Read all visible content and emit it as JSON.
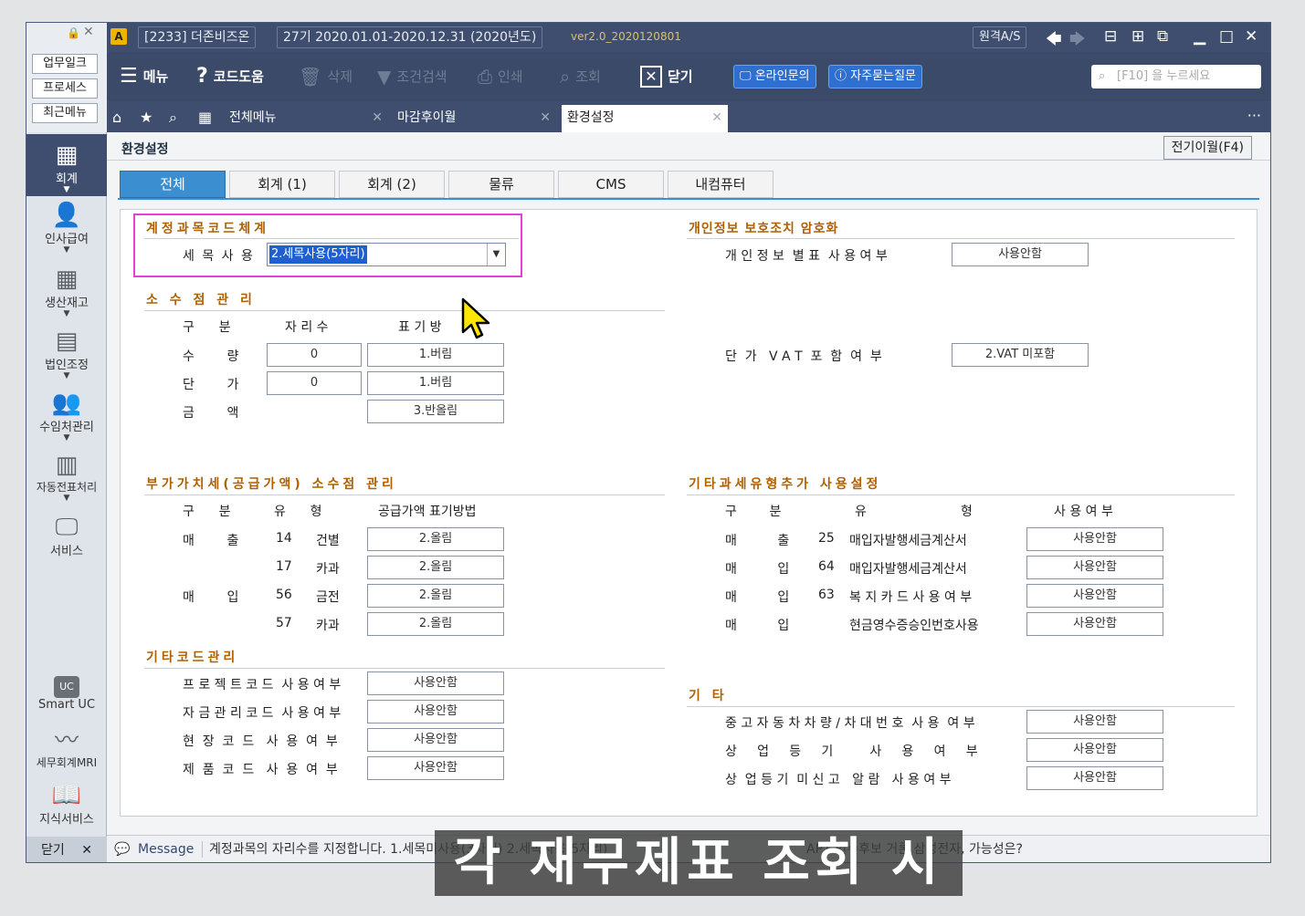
{
  "titlebar": {
    "company": "[2233] 더존비즈온",
    "period": "27기  2020.01.01-2020.12.31  (2020년도)",
    "version": "ver2.0_2020120801",
    "remote": "원격A/S"
  },
  "sidebar": {
    "buttons": [
      "업무일크",
      "프로세스",
      "최근메뉴"
    ],
    "nav": [
      "회계",
      "인사급여",
      "생산재고",
      "법인조정",
      "수임처관리",
      "자동전표처리",
      "서비스"
    ],
    "bottom": [
      "Smart UC",
      "세무회계MRI",
      "지식서비스"
    ],
    "close_label": "닫기",
    "uc_badge": "UC"
  },
  "toolbar": {
    "menu": "메뉴",
    "code_help": "코드도움",
    "delete": "삭제",
    "condition_search": "조건검색",
    "print": "인쇄",
    "inquiry": "조회",
    "close": "닫기",
    "online_inquiry": "온라인문의",
    "faq": "자주묻는질문",
    "search_placeholder": "[F10] 을 누르세요"
  },
  "doc_tabs": [
    "전체메뉴",
    "마감후이월",
    "환경설정"
  ],
  "page": {
    "title": "환경설정",
    "carryover_button": "전기이월(F4)",
    "tabs": [
      "전체",
      "회계 (1)",
      "회계 (2)",
      "물류",
      "CMS",
      "내컴퓨터"
    ]
  },
  "account_code": {
    "title": "계정과목코드체계",
    "label": "세 목 사 용",
    "value": "2.세목사용(5자리)"
  },
  "decimal": {
    "title": "소 수 점  관 리",
    "headers": [
      "구      분",
      "자 리 수",
      "표 기 방"
    ],
    "rows": [
      {
        "label": "수        량",
        "digits": "0",
        "method": "1.버림"
      },
      {
        "label": "단        가",
        "digits": "0",
        "method": "1.버림"
      },
      {
        "label": "금        액",
        "method": "3.반올림"
      }
    ]
  },
  "privacy": {
    "title": "개인정보 보호조치 암호화",
    "label": "개 인 정 보  별 표  사 용 여 부",
    "value": "사용안함"
  },
  "vat_unit": {
    "label": "단  가   V A T  포  함  여  부",
    "value": "2.VAT 미포함"
  },
  "vat_decimal": {
    "title": "부가가치세(공급가액) 소수점 관리",
    "headers": [
      "구      분",
      "유      형",
      "공급가액 표기방법"
    ],
    "rows": [
      {
        "gubun": "매        출",
        "code": "14",
        "type": "건별",
        "value": "2.올림"
      },
      {
        "gubun": "",
        "code": "17",
        "type": "카과",
        "value": "2.올림"
      },
      {
        "gubun": "매        입",
        "code": "56",
        "type": "금전",
        "value": "2.올림"
      },
      {
        "gubun": "",
        "code": "57",
        "type": "카과",
        "value": "2.올림"
      }
    ]
  },
  "other_tax": {
    "title": "기타과세유형추가 사용설정",
    "headers": [
      "구        분",
      "유",
      "형",
      "사 용 여 부"
    ],
    "rows": [
      {
        "gubun": "매          출",
        "code": "25",
        "type": "매입자발행세금계산서",
        "value": "사용안함"
      },
      {
        "gubun": "매          입",
        "code": "64",
        "type": "매입자발행세금계산서",
        "value": "사용안함"
      },
      {
        "gubun": "매          입",
        "code": "63",
        "type": "복 지 카 드 사 용 여 부",
        "value": "사용안함"
      },
      {
        "gubun": "매          입",
        "code": "",
        "type": "현금영수증승인번호사용",
        "value": "사용안함"
      }
    ]
  },
  "other_code": {
    "title": "기타코드관리",
    "rows": [
      {
        "label": "프 로 젝 트 코 드  사 용 여 부",
        "value": "사용안함"
      },
      {
        "label": "자 금 관 리 코 드  사 용 여 부",
        "value": "사용안함"
      },
      {
        "label": "현  장  코  드   사  용  여  부",
        "value": "사용안함"
      },
      {
        "label": "제  품  코  드   사  용  여  부",
        "value": "사용안함"
      }
    ]
  },
  "etc": {
    "title": "기 타",
    "rows": [
      {
        "label": "중 고 자 동 차 차 량 / 차 대 번 호  사 용  여 부",
        "value": "사용안함"
      },
      {
        "label": "상     업     등     기         사     용     여     부",
        "value": "사용안함"
      },
      {
        "label": "상  업 등 기  미 신 고   알 람   사 용 여 부",
        "value": "사용안함"
      }
    ]
  },
  "message": {
    "label": "Message",
    "text": "계정과목의 자리수를 지정합니다. 1.세목미사용(3자리) 2.세목사용(5자리)",
    "news": "AP1 인수후보 거론 삼성전자, 가능성은?"
  },
  "subtitle": "각 재무제표 조회 시",
  "colors": {
    "accent": "#3b8fd0",
    "highlight": "#e33fd9",
    "section": "#b06000",
    "titlebar": "#3f4e6e"
  }
}
